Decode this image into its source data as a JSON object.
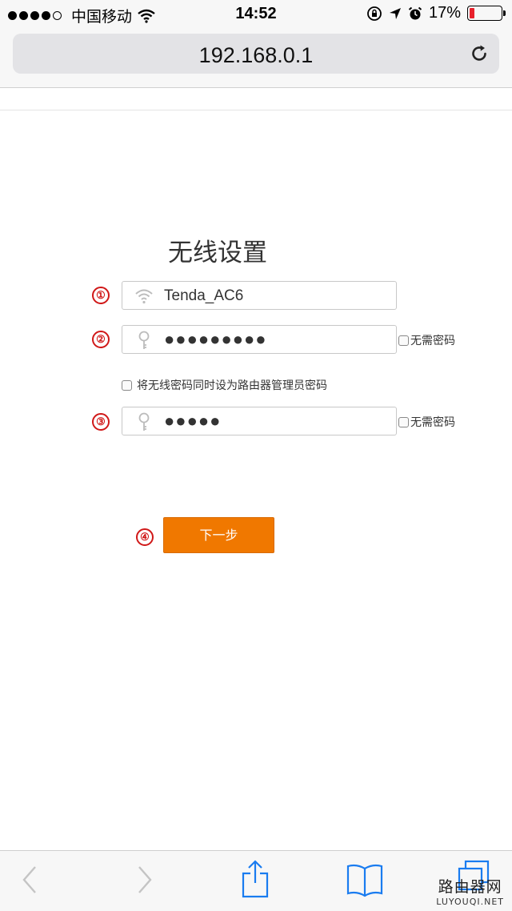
{
  "status_bar": {
    "carrier": "中国移动",
    "time": "14:52",
    "battery": "17%",
    "battery_level": 0.17,
    "signal_bars": 4,
    "battery_color": "#e8202b"
  },
  "browser": {
    "url": "192.168.0.1"
  },
  "page": {
    "title": "无线设置",
    "step_numbers": [
      "①",
      "②",
      "③",
      "④"
    ],
    "ssid_value": "Tenda_AC6",
    "wifi_password_masked": "●●●●●●●●●",
    "no_password_label_1": "无需密码",
    "same_password_label": "将无线密码同时设为路由器管理员密码",
    "admin_password_masked": "●●●●●",
    "no_password_label_2": "无需密码",
    "next_button": "下一步",
    "accent_color": "#f07800",
    "marker_color": "#d01818"
  },
  "toolbar": {
    "icons": [
      "back-icon",
      "forward-icon",
      "share-icon",
      "bookmarks-icon",
      "tabs-icon"
    ]
  },
  "watermark": {
    "line1": "路由器网",
    "line2": "LUYOUQI.NET"
  }
}
